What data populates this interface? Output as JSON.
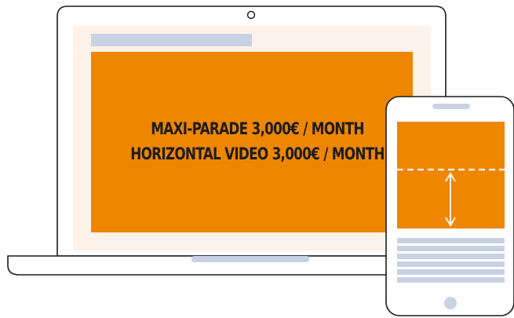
{
  "ad": {
    "line1": "MAXI-PARADE 3,000€ / MONTH",
    "line2": "HORIZONTAL VIDEO 3,000€ / MONTH"
  },
  "colors": {
    "accent_orange": "#ef8600",
    "screen_bg": "#fdf3ea",
    "placeholder_blue": "#c9d2e3",
    "outline": "#1c1c1c",
    "dashed_line": "#ffffff"
  },
  "icons": {
    "laptop": "laptop-icon",
    "phone": "smartphone-icon",
    "scroll_arrow": "double-arrow-vertical-icon"
  }
}
